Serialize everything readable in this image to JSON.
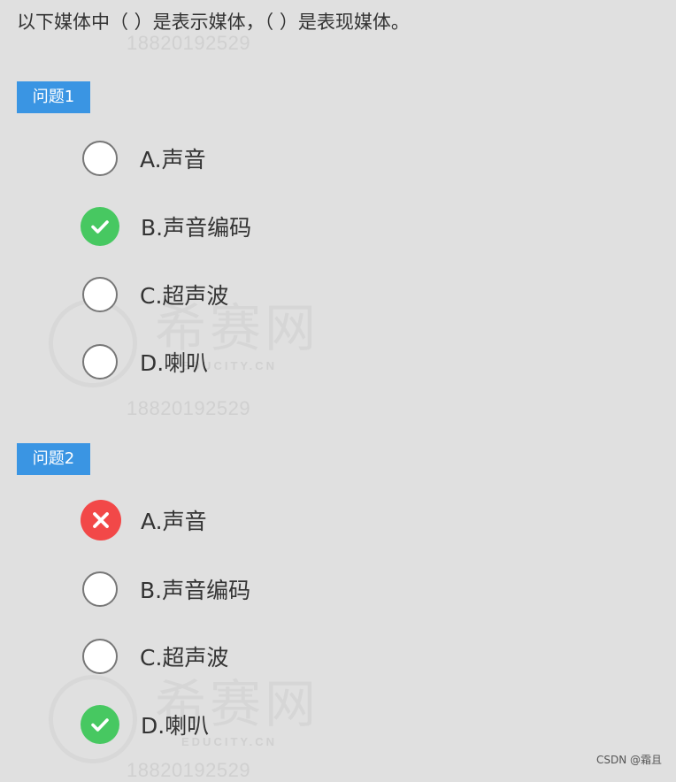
{
  "question": {
    "text": "以下媒体中（ ）是表示媒体，（ ）是表现媒体。"
  },
  "watermark": {
    "phone": "18820192529",
    "logo_text": "希赛网",
    "logo_sub": "EDUCITY.CN"
  },
  "sections": [
    {
      "label": "问题1",
      "options": [
        {
          "label": "A.声音",
          "state": "unselected"
        },
        {
          "label": "B.声音编码",
          "state": "correct"
        },
        {
          "label": "C.超声波",
          "state": "unselected"
        },
        {
          "label": "D.喇叭",
          "state": "unselected"
        }
      ]
    },
    {
      "label": "问题2",
      "options": [
        {
          "label": "A.声音",
          "state": "wrong"
        },
        {
          "label": "B.声音编码",
          "state": "unselected"
        },
        {
          "label": "C.超声波",
          "state": "unselected"
        },
        {
          "label": "D.喇叭",
          "state": "correct"
        }
      ]
    }
  ],
  "icons": {
    "correct": "check-icon",
    "wrong": "cross-icon"
  },
  "colors": {
    "background": "#e0e0e0",
    "section_label_bg": "#3a95e3",
    "correct": "#47c861",
    "wrong": "#f24848"
  },
  "footer": {
    "credit": "CSDN @霜且"
  }
}
